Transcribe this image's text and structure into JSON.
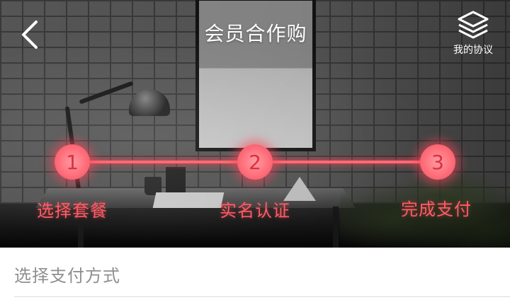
{
  "header": {
    "title": "会员合作购",
    "back_icon": "chevron-left-icon",
    "agreement": {
      "icon": "layers-icon",
      "label": "我的协议"
    }
  },
  "steps": [
    {
      "number": "1",
      "label": "选择套餐"
    },
    {
      "number": "2",
      "label": "实名认证"
    },
    {
      "number": "3",
      "label": "完成支付"
    }
  ],
  "payment": {
    "section_title": "选择支付方式"
  },
  "colors": {
    "step_accent": "#ff5b66",
    "text_white": "#ffffff",
    "section_text": "#8f8f8f"
  }
}
